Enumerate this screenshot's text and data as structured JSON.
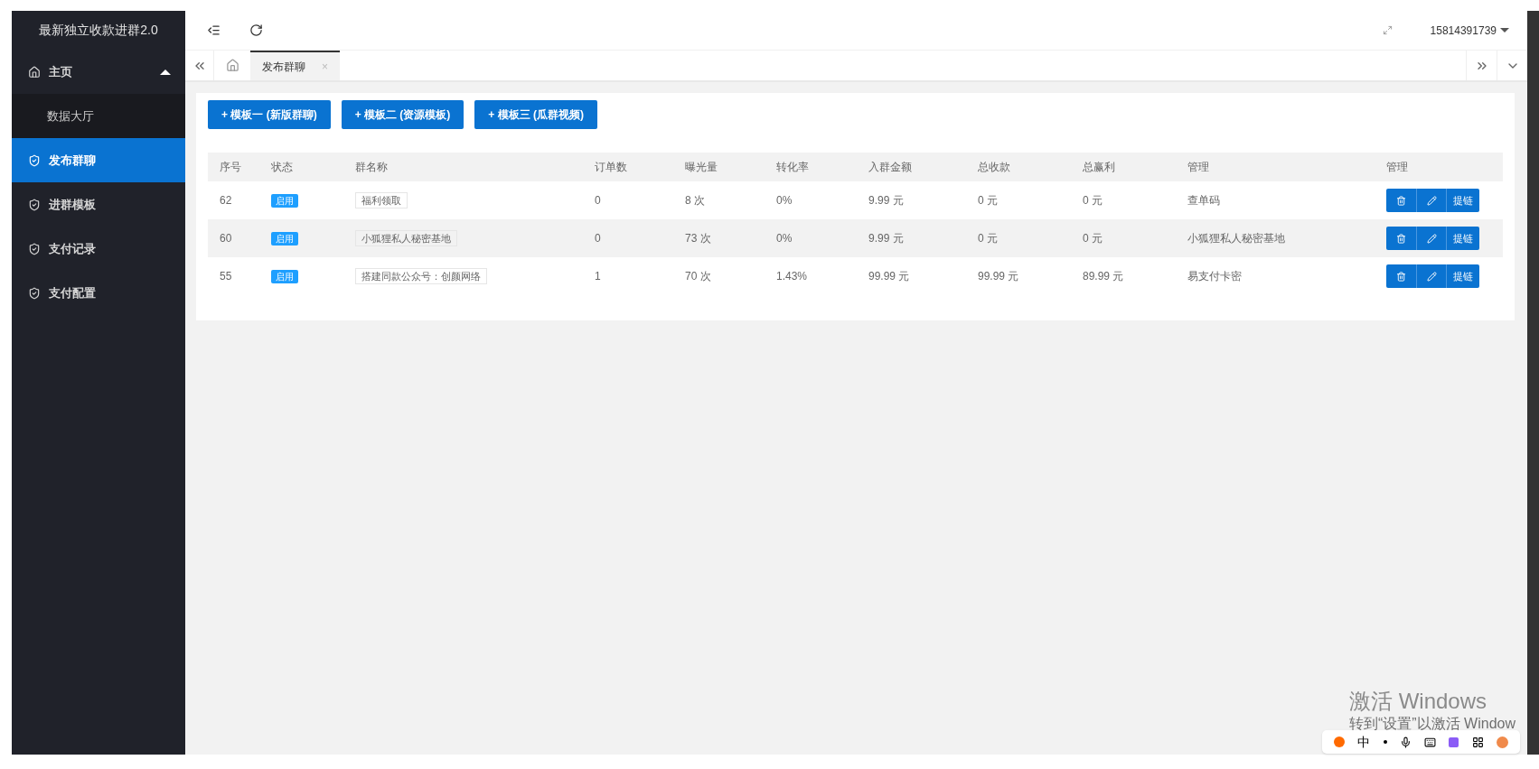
{
  "sidebar": {
    "title": "最新独立收款进群2.0",
    "items": [
      {
        "kind": "parent",
        "label": "主页",
        "expanded": true,
        "selected": false,
        "children": [
          {
            "label": "数据大厅",
            "selected": false
          }
        ]
      },
      {
        "kind": "item",
        "label": "发布群聊",
        "selected": true
      },
      {
        "kind": "item",
        "label": "进群模板",
        "selected": false
      },
      {
        "kind": "item",
        "label": "支付记录",
        "selected": false
      },
      {
        "kind": "item",
        "label": "支付配置",
        "selected": false
      }
    ]
  },
  "header": {
    "user": "15814391739"
  },
  "tabs": [
    {
      "label": "发布群聊",
      "selected": true,
      "close": "×"
    }
  ],
  "buttons": [
    "+ 模板一 (新版群聊)",
    "+ 模板二 (资源模板)",
    "+ 模板三 (瓜群视频)"
  ],
  "table": {
    "columns": [
      "序号",
      "状态",
      "群名称",
      "订单数",
      "曝光量",
      "转化率",
      "入群金额",
      "总收款",
      "总赢利",
      "管理",
      "管理"
    ],
    "rows": [
      {
        "id": "62",
        "status": "启用",
        "name": "福利领取",
        "orders": "0",
        "views": "8 次",
        "rate": "0%",
        "price": "9.99 元",
        "total": "0 元",
        "profit": "0 元",
        "manage": "查单码",
        "link": "提链"
      },
      {
        "id": "60",
        "status": "启用",
        "name": "小狐狸私人秘密基地",
        "orders": "0",
        "views": "73 次",
        "rate": "0%",
        "price": "9.99 元",
        "total": "0 元",
        "profit": "0 元",
        "manage": "小狐狸私人秘密基地",
        "link": "提链"
      },
      {
        "id": "55",
        "status": "启用",
        "name": "搭建同款公众号：创颜网络",
        "orders": "1",
        "views": "70 次",
        "rate": "1.43%",
        "price": "99.99 元",
        "total": "99.99 元",
        "profit": "89.99 元",
        "manage": "易支付卡密",
        "link": "提链"
      }
    ]
  },
  "os_overlay": {
    "title": "激活 Windows",
    "subtitle": "转到“设置”以激活 Window",
    "ime": "中"
  }
}
